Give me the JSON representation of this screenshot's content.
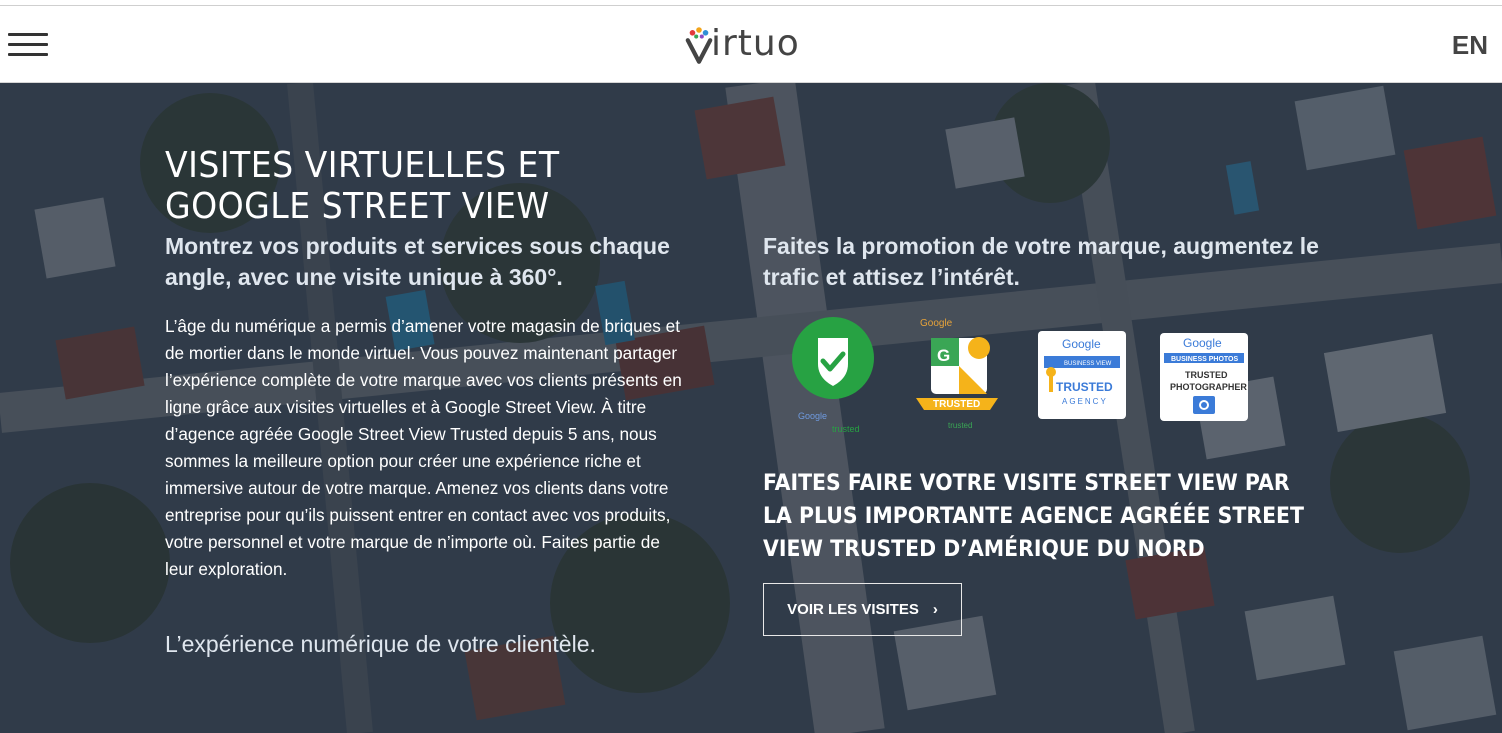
{
  "header": {
    "logo_text": "irtuo",
    "language": "EN"
  },
  "hero": {
    "title": "VISITES VIRTUELLES ET GOOGLE STREET VIEW",
    "subtitle": "Montrez vos produits et services sous chaque angle, avec une visite unique à 360°.",
    "body": "L’âge du numérique a permis d’amener votre magasin de briques et de mortier dans le monde virtuel. Vous pouvez maintenant partager l’expérience complète de votre marque avec vos clients présents en ligne grâce aux visites virtuelles et à Google Street View. À titre d’agence agréée Google Street View Trusted depuis 5 ans, nous sommes la meilleure option pour créer une expérience riche et immersive autour de votre marque. Amenez vos clients dans votre entreprise pour qu’ils puissent entrer en contact avec vos produits, votre personnel et votre marque de n’importe où. Faites partie de leur exploration.",
    "tagline": "L’expérience numérique de votre clientèle.",
    "promo": "Faites la promotion de votre marque, augmentez le trafic et attisez l’intérêt.",
    "badges": {
      "badge1_brand": "Google",
      "badge1_sub": "trusted",
      "badge2_brand": "Google",
      "badge2_label": "TRUSTED",
      "badge2_sub": "trusted",
      "badge3_brand": "Google",
      "badge3_kind": "BUSINESS VIEW",
      "badge3_line1": "TRUSTED",
      "badge3_line2": "AGENCY",
      "badge4_brand": "Google",
      "badge4_kind": "BUSINESS PHOTOS",
      "badge4_line1": "TRUSTED",
      "badge4_line2": "PHOTOGRAPHER"
    },
    "headline2": "FAITES FAIRE VOTRE VISITE STREET VIEW PAR LA PLUS IMPORTANTE AGENCE AGRÉÉE STREET VIEW TRUSTED D’AMÉRIQUE DU NORD",
    "cta_label": "VOIR LES VISITES",
    "cta_icon": "›"
  },
  "colors": {
    "overlay": "#1c2636",
    "badge_green": "#27a243",
    "badge_yellow": "#f5b31a",
    "google_blue": "#3b7bd8"
  }
}
